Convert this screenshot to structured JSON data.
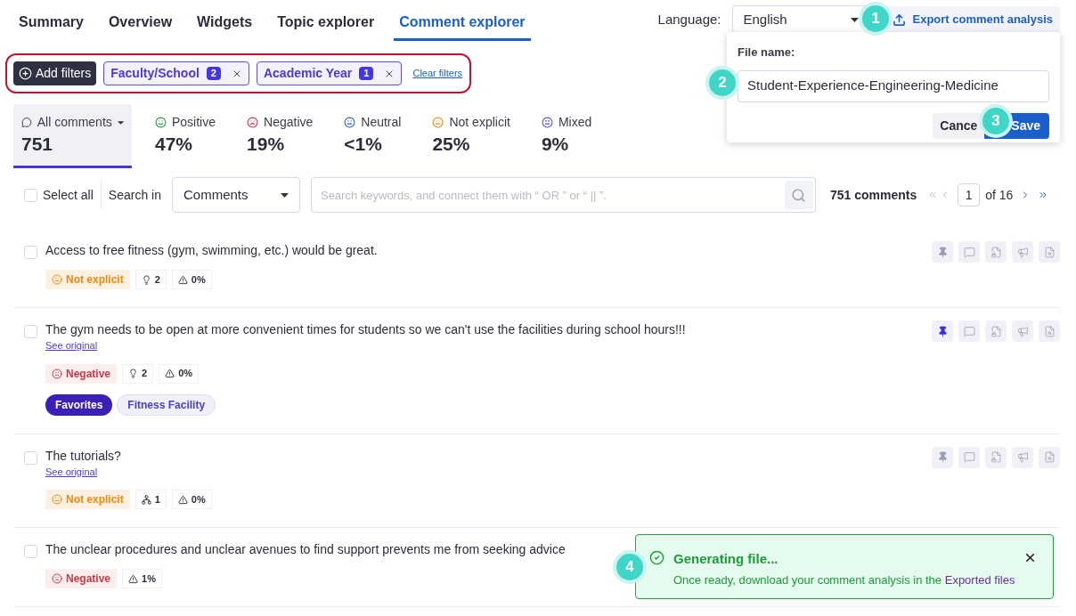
{
  "tabs": [
    {
      "label": "Summary",
      "selected": false
    },
    {
      "label": "Overview",
      "selected": false
    },
    {
      "label": "Widgets",
      "selected": false
    },
    {
      "label": "Topic explorer",
      "selected": false
    },
    {
      "label": "Comment explorer",
      "selected": true
    }
  ],
  "language": {
    "label": "Language:",
    "value": "English"
  },
  "export_button": "Export comment analysis",
  "export_popover": {
    "label": "File name:",
    "value": "Student-Experience-Engineering-Medicine",
    "cancel": "Cance",
    "save": "Save"
  },
  "filters": {
    "add": "Add filters",
    "chips": [
      {
        "label": "Faculty/School",
        "count": "2"
      },
      {
        "label": "Academic Year",
        "count": "1"
      }
    ],
    "clear": "Clear filters"
  },
  "stats": [
    {
      "kind": "all",
      "label": "All comments",
      "value": "751",
      "selected": true
    },
    {
      "kind": "positive",
      "label": "Positive",
      "value": "47%",
      "selected": false
    },
    {
      "kind": "negative",
      "label": "Negative",
      "value": "19%",
      "selected": false
    },
    {
      "kind": "neutral",
      "label": "Neutral",
      "value": "<1%",
      "selected": false
    },
    {
      "kind": "not_explicit",
      "label": "Not explicit",
      "value": "25%",
      "selected": false
    },
    {
      "kind": "mixed",
      "label": "Mixed",
      "value": "9%",
      "selected": false
    }
  ],
  "toolbar": {
    "select_all": {
      "label": "Select all",
      "checked": false
    },
    "search_in": "Search in",
    "scope": "Comments",
    "placeholder": "Search keywords, and connect them with “ OR ” or “ || ”.",
    "count": "751 comments",
    "page": "1",
    "of": "of 16"
  },
  "comments": [
    {
      "text": "Access to free fitness (gym, swimming, etc.) would be great.",
      "checked": false,
      "pinned": false,
      "sentiment": {
        "kind": "not_explicit",
        "label": "Not explicit"
      },
      "metrics": [
        {
          "kind": "ideas",
          "value": "2"
        },
        {
          "kind": "risk",
          "value": "0%"
        }
      ]
    },
    {
      "text": "The gym needs to be open at more convenient times for students so we can't use the facilities during school hours!!!",
      "see_original": "See original",
      "checked": false,
      "pinned": true,
      "sentiment": {
        "kind": "negative",
        "label": "Negative"
      },
      "metrics": [
        {
          "kind": "ideas",
          "value": "2"
        },
        {
          "kind": "risk",
          "value": "0%"
        }
      ],
      "labels": [
        {
          "kind": "favorite",
          "text": "Favorites"
        },
        {
          "kind": "topic",
          "text": "Fitness Facility"
        }
      ]
    },
    {
      "text": "The tutorials?",
      "see_original": "See original",
      "checked": false,
      "pinned": false,
      "sentiment": {
        "kind": "not_explicit",
        "label": "Not explicit"
      },
      "metrics": [
        {
          "kind": "topics",
          "value": "1"
        },
        {
          "kind": "risk",
          "value": "0%"
        }
      ]
    },
    {
      "text": "The unclear procedures and unclear avenues to find support prevents me from seeking advice",
      "checked": false,
      "sentiment": {
        "kind": "negative",
        "label": "Negative"
      },
      "metrics": [
        {
          "kind": "risk",
          "value": "1%"
        }
      ]
    }
  ],
  "toast": {
    "title": "Generating file...",
    "message": "Once ready, download your comment analysis in the",
    "link": "Exported files"
  },
  "callouts": [
    "1",
    "2",
    "3",
    "4"
  ]
}
